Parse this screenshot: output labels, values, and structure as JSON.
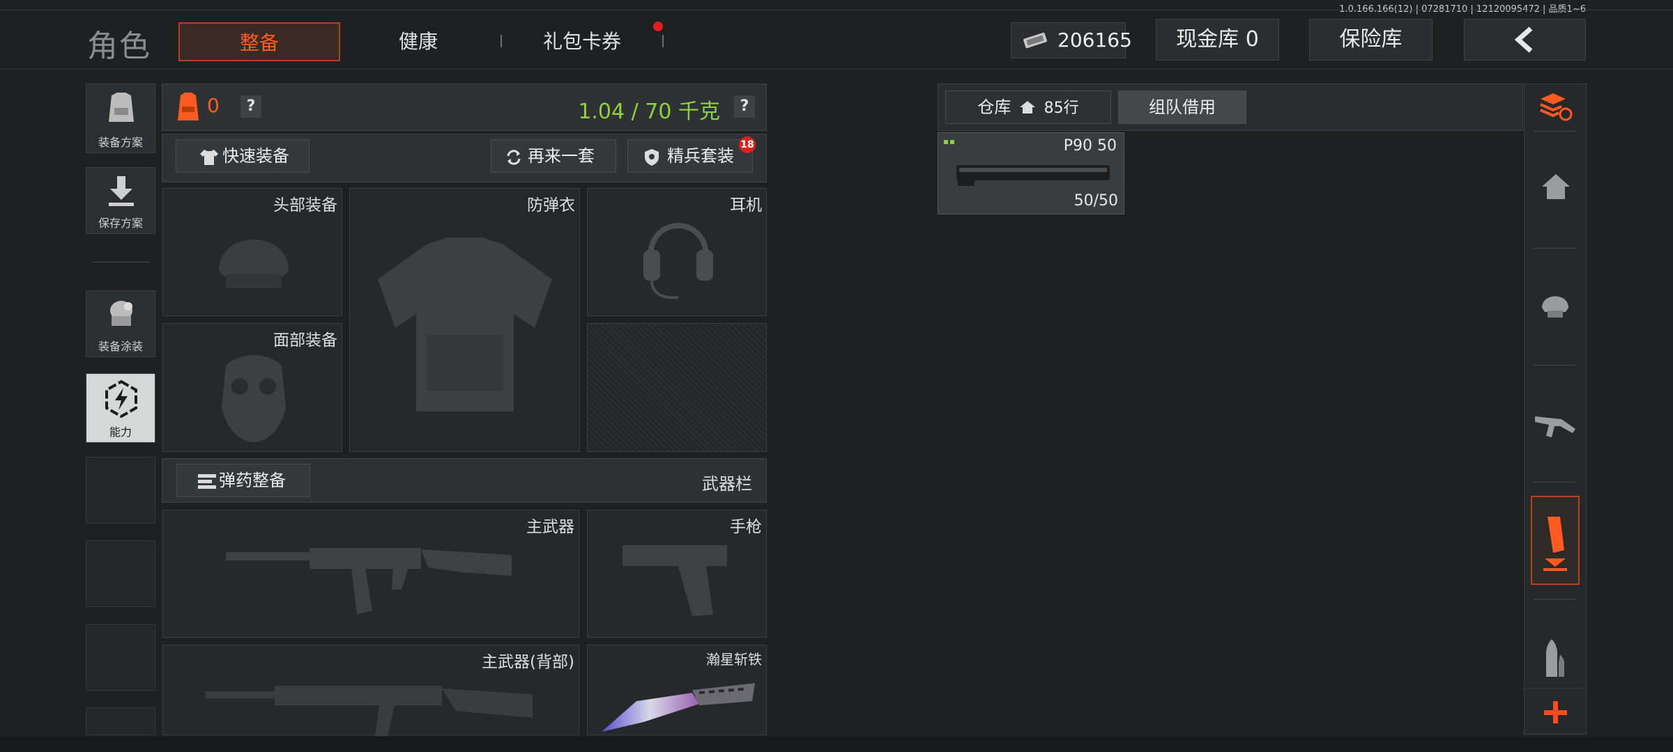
{
  "version": "1.0.166.166(12) | 07281710 | 12120095472 | 品质1~6",
  "header": {
    "title": "角色",
    "tabs": [
      {
        "label": "整备",
        "active": true
      },
      {
        "label": "健康",
        "active": false
      },
      {
        "label": "礼包卡券",
        "active": false,
        "has_dot": true
      }
    ],
    "money": "206165",
    "cash_vault": "现金库 0",
    "safe_box": "保险库"
  },
  "sidebar": {
    "items": [
      {
        "label": "装备方案",
        "icon": "vest-icon"
      },
      {
        "label": "保存方案",
        "icon": "download-icon"
      },
      {
        "label": "装备涂装",
        "icon": "helmet-paint-icon"
      },
      {
        "label": "能力",
        "icon": "ability-icon",
        "active": true
      }
    ]
  },
  "loadout": {
    "armor_level": "0",
    "weight": "1.04 / 70 千克",
    "quick_equip": "快速装备",
    "again": "再来一套",
    "elite_set": "精兵套装",
    "elite_badge": "18",
    "slots": {
      "head": "头部装备",
      "vest": "防弹衣",
      "headset": "耳机",
      "face": "面部装备"
    },
    "ammo_equip": "弹药整备",
    "weapon_bar": "武器栏",
    "weapons": {
      "primary": "主武器",
      "pistol": "手枪",
      "primary_back": "主武器(背部)",
      "melee": "瀚星斩铁"
    }
  },
  "warehouse": {
    "tab_storage": "仓库",
    "rows": "85行",
    "tab_team": "组队借用",
    "item": {
      "name": "P90 50",
      "count": "50/50"
    }
  },
  "colors": {
    "accent": "#ff5a1f",
    "weight": "#8fd13a",
    "dot": "#e02020"
  }
}
